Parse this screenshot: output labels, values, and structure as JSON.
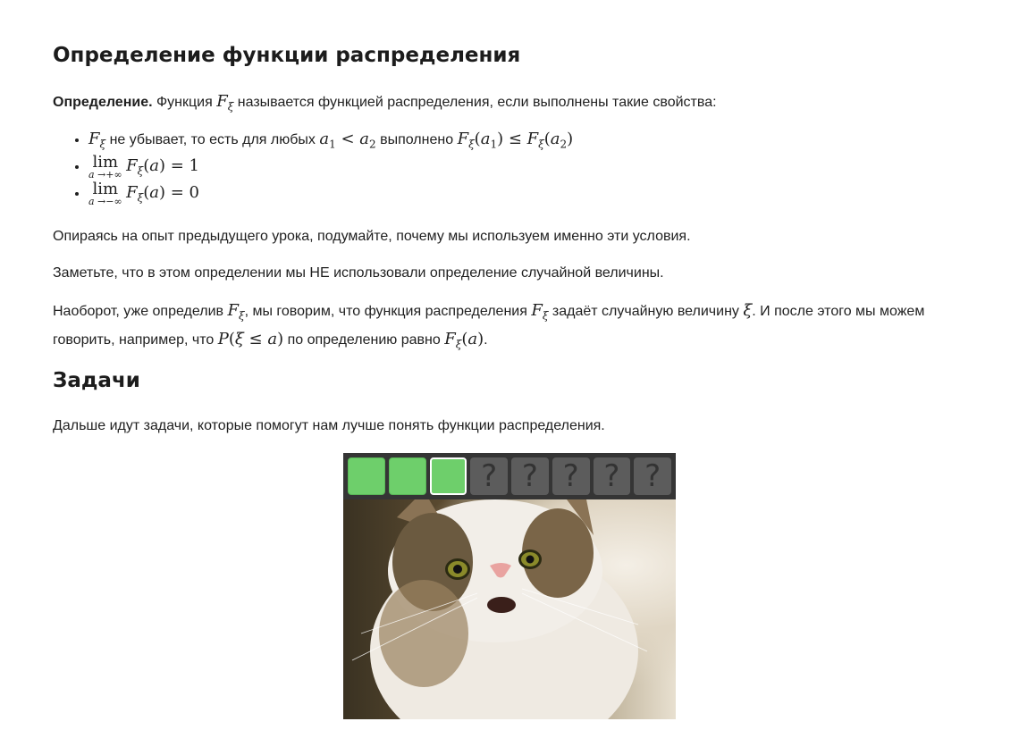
{
  "heading_definition": "Определение функции распределения",
  "definition": {
    "bold": "Определение.",
    "pre": "Функция",
    "post": "называется функцией распределения, если выполнены такие свойства:"
  },
  "properties": {
    "p1_text": "не убывает, то есть для любых",
    "p1_mid": "выполнено",
    "p2_lim_sub": "a →+∞",
    "p2_value": "= 1",
    "p3_lim_sub": "a →−∞",
    "p3_value": "= 0"
  },
  "para1": "Опираясь на опыт предыдущего урока, подумайте, почему мы используем именно эти условия.",
  "para2": "Заметьте, что в этом определении мы НЕ использовали определение случайной величины.",
  "para3": {
    "a": "Наоборот, уже определив",
    "b": ", мы говорим, что функция распределения",
    "c": "задаёт случайную величину",
    "d": ". И после этого мы можем говорить, например, что",
    "e": "по определению равно",
    "f": "."
  },
  "heading_tasks": "Задачи",
  "tasks_intro": "Дальше идут задачи, которые помогут нам лучше понять функции распределения.",
  "progress": {
    "tiles": [
      {
        "state": "done",
        "label": ""
      },
      {
        "state": "done",
        "label": ""
      },
      {
        "state": "current",
        "label": ""
      },
      {
        "state": "locked",
        "label": "?"
      },
      {
        "state": "locked",
        "label": "?"
      },
      {
        "state": "locked",
        "label": "?"
      },
      {
        "state": "locked",
        "label": "?"
      },
      {
        "state": "locked",
        "label": "?"
      }
    ]
  },
  "colors": {
    "done": "#6ecf6b",
    "locked": "#5c5c5c",
    "bar": "#353535"
  }
}
